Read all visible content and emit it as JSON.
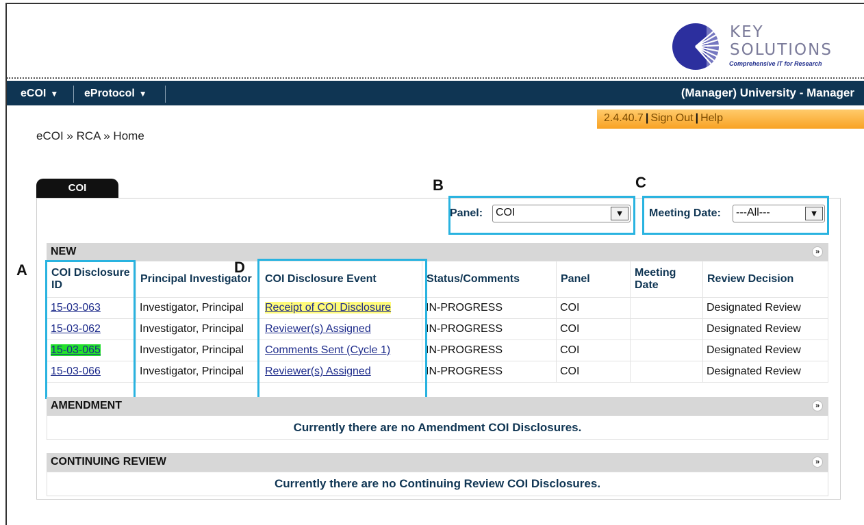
{
  "logo": {
    "line1": "KEY",
    "line2": "SOLUTIONS",
    "tagline": "Comprehensive IT for Research"
  },
  "nav": {
    "items": [
      {
        "label": "eCOI"
      },
      {
        "label": "eProtocol"
      }
    ],
    "user": "(Manager) University - Manager"
  },
  "utility": {
    "version": "2.4.40.7",
    "sign_out": "Sign Out",
    "help": "Help"
  },
  "breadcrumb": "eCOI » RCA » Home",
  "tab": "COI",
  "annotations": {
    "a": "A",
    "b": "B",
    "c": "C",
    "d": "D"
  },
  "filters": {
    "panel_label": "Panel:",
    "panel_value": "COI",
    "meeting_label": "Meeting Date:",
    "meeting_value": "---All---"
  },
  "sections": {
    "new": "NEW",
    "amendment": "AMENDMENT",
    "amendment_msg": "Currently there are no Amendment COI Disclosures.",
    "continuing": "CONTINUING REVIEW",
    "continuing_msg": "Currently there are no Continuing Review COI Disclosures."
  },
  "table": {
    "headers": [
      "COI Disclosure ID",
      "Principal Investigator",
      "COI Disclosure Event",
      "Status/Comments",
      "Panel",
      "Meeting Date",
      "Review Decision"
    ],
    "rows": [
      [
        "15-03-063",
        "Investigator, Principal",
        "Receipt of COI Disclosure",
        "IN-PROGRESS",
        "COI",
        "",
        "Designated Review"
      ],
      [
        "15-03-062",
        "Investigator, Principal",
        "Reviewer(s) Assigned",
        "IN-PROGRESS",
        "COI",
        "",
        "Designated Review"
      ],
      [
        "15-03-065",
        "Investigator, Principal",
        "Comments Sent (Cycle 1)",
        "IN-PROGRESS",
        "COI",
        "",
        "Designated Review"
      ],
      [
        "15-03-066",
        "Investigator, Principal",
        "Reviewer(s) Assigned",
        "IN-PROGRESS",
        "COI",
        "",
        "Designated Review"
      ]
    ]
  },
  "colors": {
    "nav": "#0f3553",
    "highlight": "#29b3e0",
    "orange": "#f8a224",
    "yellow": "#fffb7a",
    "green": "#22e12b"
  }
}
